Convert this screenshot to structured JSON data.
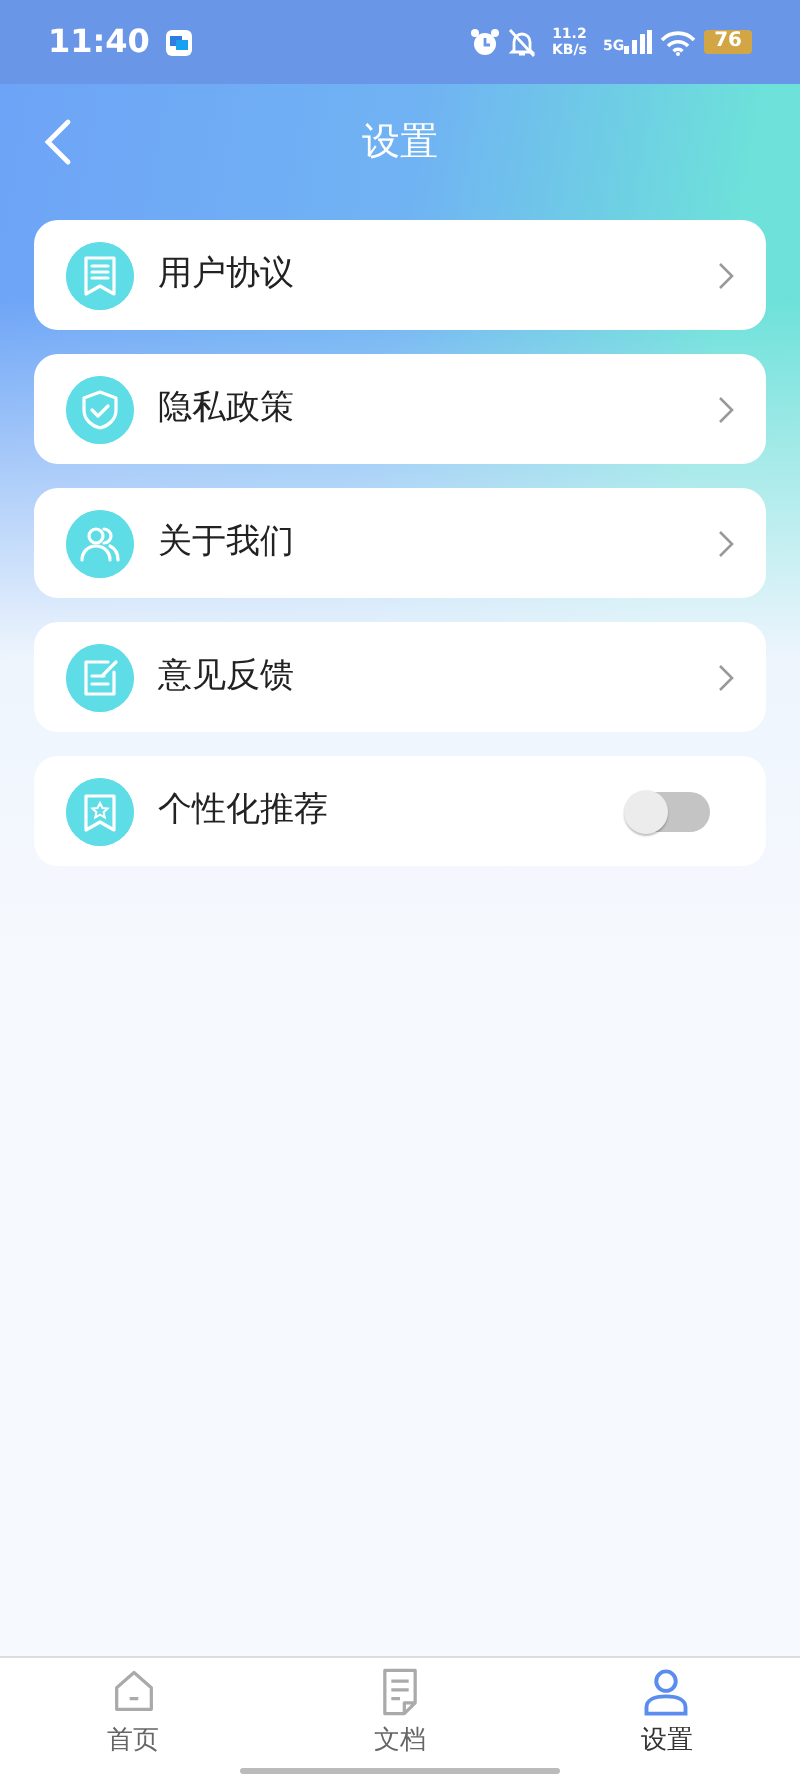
{
  "status_bar": {
    "time": "11:40",
    "speed": "11.2",
    "speed_unit": "KB/s",
    "network": "5G",
    "battery": "76"
  },
  "header": {
    "title": "设置"
  },
  "items": [
    {
      "label": "用户协议",
      "kind": "link"
    },
    {
      "label": "隐私政策",
      "kind": "link"
    },
    {
      "label": "关于我们",
      "kind": "link"
    },
    {
      "label": "意见反馈",
      "kind": "link"
    },
    {
      "label": "个性化推荐",
      "kind": "toggle",
      "on": false
    }
  ],
  "tabs": [
    {
      "label": "首页",
      "selected": false
    },
    {
      "label": "文档",
      "selected": false
    },
    {
      "label": "设置",
      "selected": true
    }
  ]
}
